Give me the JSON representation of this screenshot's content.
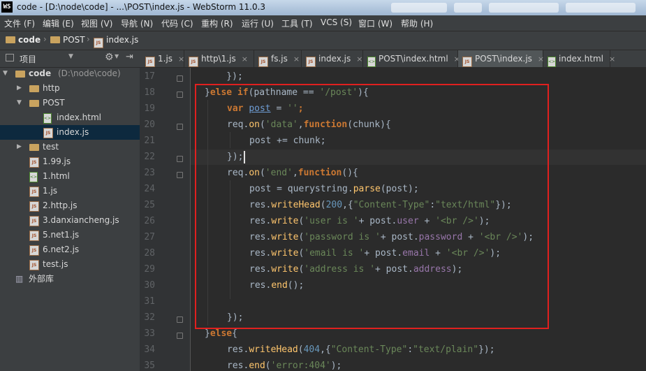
{
  "window": {
    "title": "code - [D:\\node\\code] - ...\\POST\\index.js - WebStorm 11.0.3",
    "app_badge": "WS"
  },
  "menu": [
    "文件 (F)",
    "编辑 (E)",
    "视图 (V)",
    "导航 (N)",
    "代码 (C)",
    "重构 (R)",
    "运行 (U)",
    "工具 (T)",
    "VCS (S)",
    "窗口 (W)",
    "帮助 (H)"
  ],
  "breadcrumb": [
    "code",
    "POST",
    "index.js"
  ],
  "project_panel": {
    "title": "项目",
    "tree": [
      {
        "label": "code",
        "sublabel": "(D:\\node\\code)",
        "type": "folder",
        "depth": 0,
        "expanded": true
      },
      {
        "label": "http",
        "type": "folder",
        "depth": 1,
        "expanded": false
      },
      {
        "label": "POST",
        "type": "folder",
        "depth": 1,
        "expanded": true
      },
      {
        "label": "index.html",
        "type": "html",
        "depth": 2
      },
      {
        "label": "index.js",
        "type": "js",
        "depth": 2,
        "selected": true
      },
      {
        "label": "test",
        "type": "folder",
        "depth": 1,
        "expanded": false
      },
      {
        "label": "1.99.js",
        "type": "js",
        "depth": 1
      },
      {
        "label": "1.html",
        "type": "html",
        "depth": 1
      },
      {
        "label": "1.js",
        "type": "js",
        "depth": 1
      },
      {
        "label": "2.http.js",
        "type": "js",
        "depth": 1
      },
      {
        "label": "3.danxiancheng.js",
        "type": "js",
        "depth": 1
      },
      {
        "label": "5.net1.js",
        "type": "js",
        "depth": 1
      },
      {
        "label": "6.net2.js",
        "type": "js",
        "depth": 1
      },
      {
        "label": "test.js",
        "type": "js",
        "depth": 1
      },
      {
        "label": "外部库",
        "type": "lib",
        "depth": 0
      }
    ]
  },
  "tabs": [
    {
      "label": "1.js",
      "type": "js"
    },
    {
      "label": "http\\1.js",
      "type": "js"
    },
    {
      "label": "fs.js",
      "type": "js"
    },
    {
      "label": "index.js",
      "type": "js"
    },
    {
      "label": "POST\\index.html",
      "type": "html"
    },
    {
      "label": "POST\\index.js",
      "type": "js",
      "active": true
    },
    {
      "label": "index.html",
      "type": "html"
    }
  ],
  "line_numbers": [
    "17",
    "18",
    "19",
    "20",
    "21",
    "22",
    "23",
    "24",
    "25",
    "26",
    "27",
    "28",
    "29",
    "30",
    "31",
    "32",
    "33",
    "34",
    "35"
  ],
  "code": {
    "l17": "    });",
    "l18_a": "}",
    "l18_kw1": "else if",
    "l18_b": "(pathname == ",
    "l18_str": "'/post'",
    "l18_c": "){",
    "l19_kw": "var ",
    "l19_var": "post",
    "l19_b": " = ",
    "l19_str": "''",
    "l19_c": ";",
    "l20_a": "req.",
    "l20_fn": "on",
    "l20_b": "(",
    "l20_str": "'data'",
    "l20_c": ",",
    "l20_kw": "function",
    "l20_d": "(chunk){",
    "l21": "post += chunk;",
    "l22": "});",
    "l23_a": "req.",
    "l23_fn": "on",
    "l23_b": "(",
    "l23_str": "'end'",
    "l23_c": ",",
    "l23_kw": "function",
    "l23_d": "(){",
    "l24_a": "post = querystring.",
    "l24_fn": "parse",
    "l24_b": "(post);",
    "l25_a": "res.",
    "l25_fn": "writeHead",
    "l25_b": "(",
    "l25_num": "200",
    "l25_c": ",{",
    "l25_s1": "\"Content-Type\"",
    "l25_d": ":",
    "l25_s2": "\"text/html\"",
    "l25_e": "});",
    "l26_a": "res.",
    "l26_fn": "write",
    "l26_b": "(",
    "l26_s1": "'user is '",
    "l26_c": "+ post.",
    "l26_p": "user",
    "l26_d": " + ",
    "l26_s2": "'<br />'",
    "l26_e": ");",
    "l27_a": "res.",
    "l27_fn": "write",
    "l27_b": "(",
    "l27_s1": "'password is '",
    "l27_c": "+ post.",
    "l27_p": "password",
    "l27_d": " + ",
    "l27_s2": "'<br />'",
    "l27_e": ");",
    "l28_a": "res.",
    "l28_fn": "write",
    "l28_b": "(",
    "l28_s1": "'email is '",
    "l28_c": "+ post.",
    "l28_p": "email",
    "l28_d": " + ",
    "l28_s2": "'<br />'",
    "l28_e": ");",
    "l29_a": "res.",
    "l29_fn": "write",
    "l29_b": "(",
    "l29_s1": "'address is '",
    "l29_c": "+ post.",
    "l29_p": "address",
    "l29_e": ");",
    "l30_a": "res.",
    "l30_fn": "end",
    "l30_b": "();",
    "l32": "});",
    "l33_a": "}",
    "l33_kw": "else",
    "l33_b": "{",
    "l34_a": "res.",
    "l34_fn": "writeHead",
    "l34_b": "(",
    "l34_num": "404",
    "l34_c": ",{",
    "l34_s1": "\"Content-Type\"",
    "l34_d": ":",
    "l34_s2": "\"text/plain\"",
    "l34_e": "});",
    "l35_a": "res.",
    "l35_fn": "end",
    "l35_b": "(",
    "l35_s": "'error:404'",
    "l35_c": ");"
  },
  "colors": {
    "highlight_box": "#e0201f",
    "keyword": "#cc7832",
    "string": "#6a8759",
    "function": "#ffc66d",
    "number": "#6897bb",
    "property": "#9876aa"
  }
}
